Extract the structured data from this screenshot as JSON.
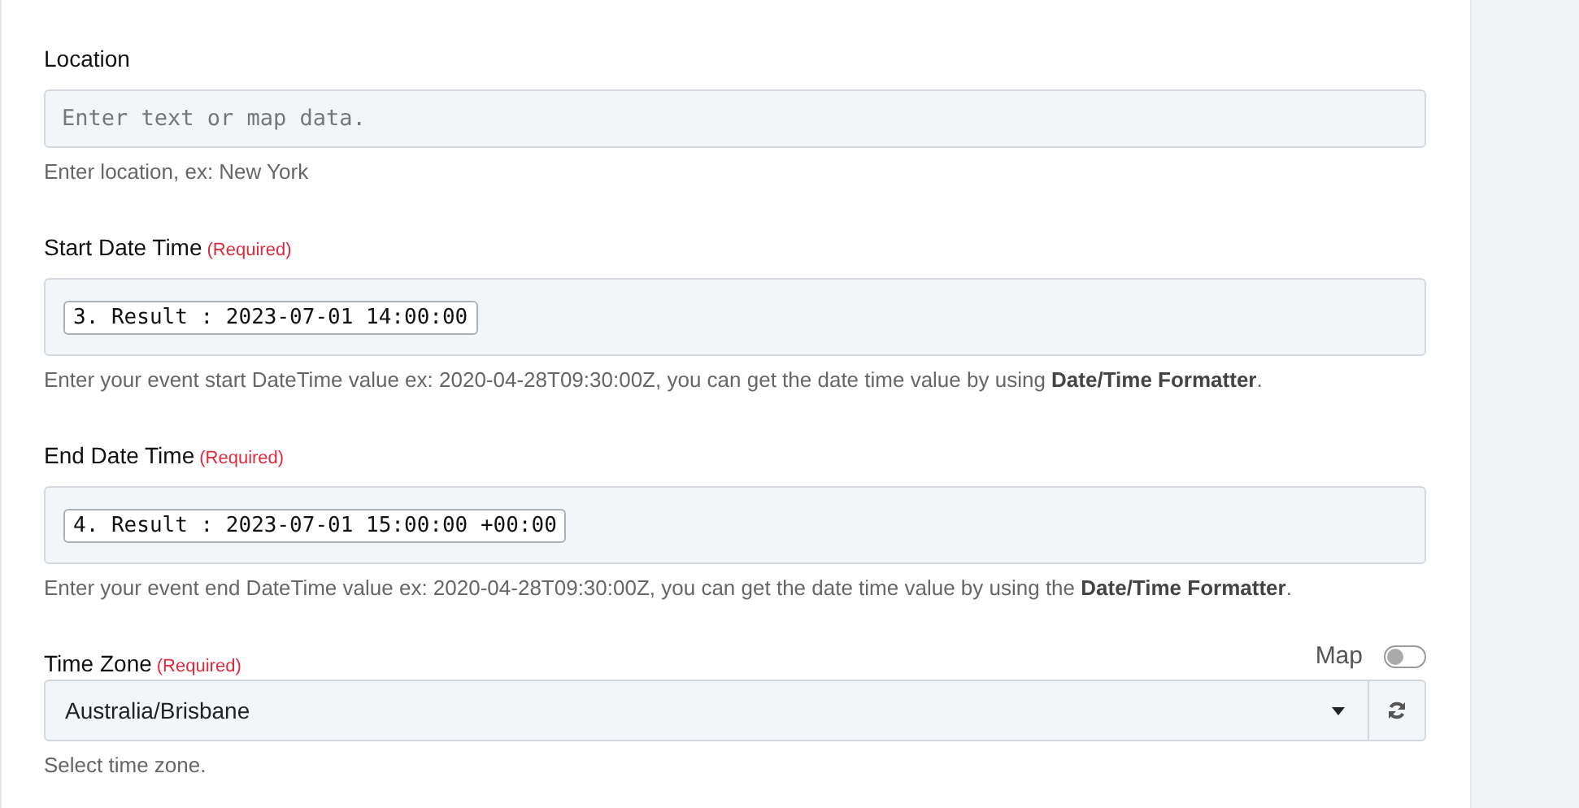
{
  "fields": [
    {
      "kind": "text",
      "label": "Location",
      "placeholder": "Enter text or map data.",
      "help": "Enter location, ex: New York"
    },
    {
      "kind": "token",
      "label": "Start Date Time",
      "required": "(Required)",
      "token": "3. Result : 2023-07-01 14:00:00",
      "help": "Enter your event start DateTime value ex: 2020-04-28T09:30:00Z, you can get the date time value by using **Date/Time Formatter**."
    },
    {
      "kind": "token",
      "label": "End Date Time",
      "required": "(Required)",
      "token": "4. Result : 2023-07-01 15:00:00 +00:00",
      "help": "Enter your event end DateTime value ex: 2020-04-28T09:30:00Z, you can get the date time value by using the **Date/Time Formatter**."
    },
    {
      "kind": "select",
      "label": "Time Zone",
      "required": "(Required)",
      "map_label": "Map",
      "map_on": false,
      "value": "Australia/Brisbane",
      "help": "Select time zone."
    }
  ]
}
